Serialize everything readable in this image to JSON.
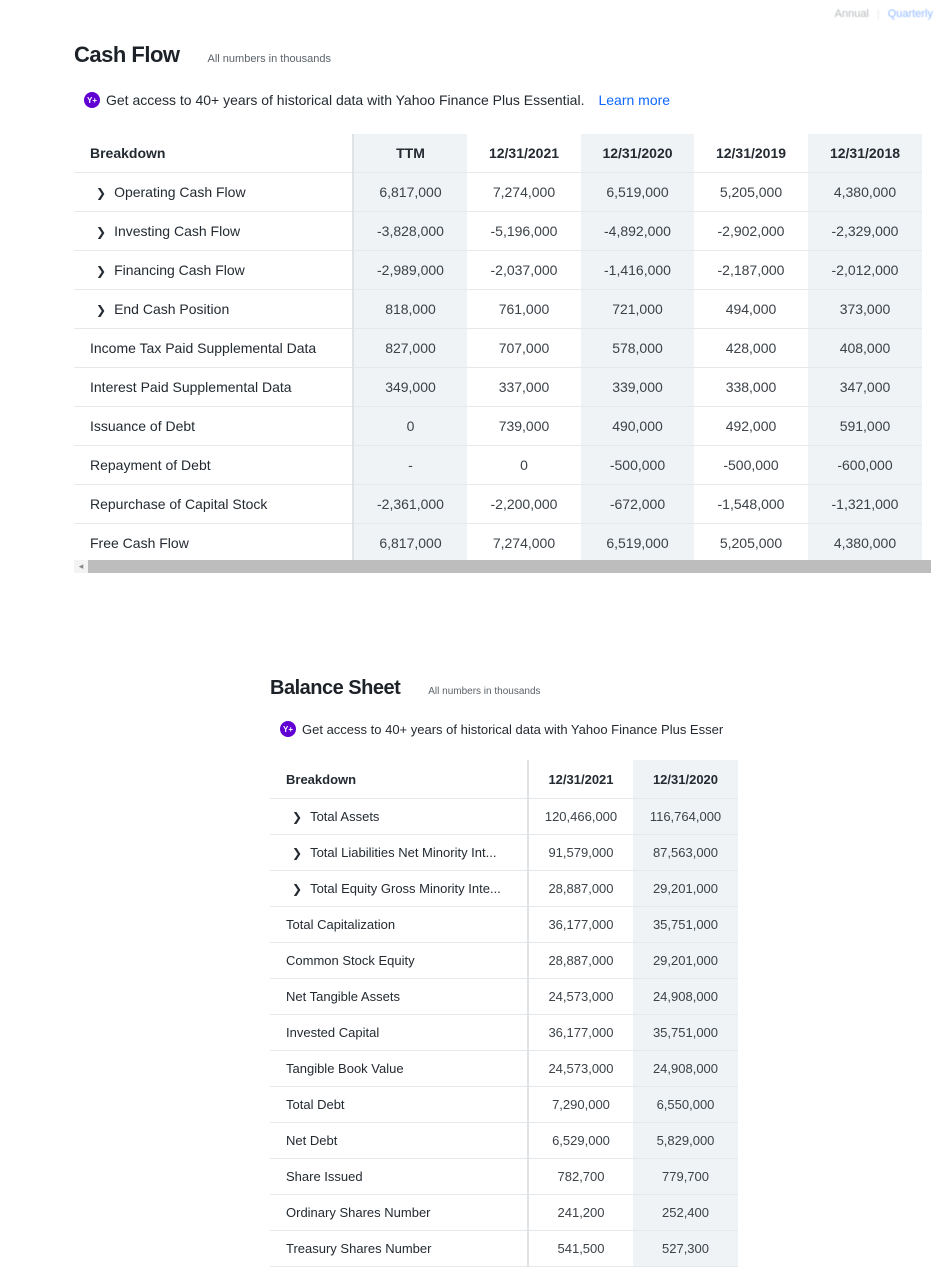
{
  "top_toggle": {
    "left": "Annual",
    "right": "Quarterly"
  },
  "cash_flow": {
    "title": "Cash Flow",
    "note": "All numbers in thousands",
    "promo_icon": "yahoo-plus-icon",
    "promo_icon_text": "Y+",
    "promo_text": "Get access to 40+ years of historical data with Yahoo Finance Plus Essential.",
    "promo_link": "Learn more",
    "columns": [
      "Breakdown",
      "TTM",
      "12/31/2021",
      "12/31/2020",
      "12/31/2019",
      "12/31/2018"
    ],
    "rows": [
      {
        "label": "Operating Cash Flow",
        "expandable": true,
        "values": [
          "6,817,000",
          "7,274,000",
          "6,519,000",
          "5,205,000",
          "4,380,000"
        ]
      },
      {
        "label": "Investing Cash Flow",
        "expandable": true,
        "values": [
          "-3,828,000",
          "-5,196,000",
          "-4,892,000",
          "-2,902,000",
          "-2,329,000"
        ]
      },
      {
        "label": "Financing Cash Flow",
        "expandable": true,
        "values": [
          "-2,989,000",
          "-2,037,000",
          "-1,416,000",
          "-2,187,000",
          "-2,012,000"
        ]
      },
      {
        "label": "End Cash Position",
        "expandable": true,
        "values": [
          "818,000",
          "761,000",
          "721,000",
          "494,000",
          "373,000"
        ]
      },
      {
        "label": "Income Tax Paid Supplemental Data",
        "expandable": false,
        "values": [
          "827,000",
          "707,000",
          "578,000",
          "428,000",
          "408,000"
        ]
      },
      {
        "label": "Interest Paid Supplemental Data",
        "expandable": false,
        "values": [
          "349,000",
          "337,000",
          "339,000",
          "338,000",
          "347,000"
        ]
      },
      {
        "label": "Issuance of Debt",
        "expandable": false,
        "values": [
          "0",
          "739,000",
          "490,000",
          "492,000",
          "591,000"
        ]
      },
      {
        "label": "Repayment of Debt",
        "expandable": false,
        "values": [
          "-",
          "0",
          "-500,000",
          "-500,000",
          "-600,000"
        ]
      },
      {
        "label": "Repurchase of Capital Stock",
        "expandable": false,
        "values": [
          "-2,361,000",
          "-2,200,000",
          "-672,000",
          "-1,548,000",
          "-1,321,000"
        ]
      },
      {
        "label": "Free Cash Flow",
        "expandable": false,
        "values": [
          "6,817,000",
          "7,274,000",
          "6,519,000",
          "5,205,000",
          "4,380,000"
        ]
      }
    ]
  },
  "balance_sheet": {
    "title": "Balance Sheet",
    "note": "All numbers in thousands",
    "promo_icon": "yahoo-plus-icon",
    "promo_icon_text": "Y+",
    "promo_text": "Get access to 40+ years of historical data with Yahoo Finance Plus Esser",
    "columns": [
      "Breakdown",
      "12/31/2021",
      "12/31/2020"
    ],
    "rows": [
      {
        "label": "Total Assets",
        "expandable": true,
        "values": [
          "120,466,000",
          "116,764,000"
        ]
      },
      {
        "label": "Total Liabilities Net Minority Int...",
        "expandable": true,
        "values": [
          "91,579,000",
          "87,563,000"
        ]
      },
      {
        "label": "Total Equity Gross Minority Inte...",
        "expandable": true,
        "values": [
          "28,887,000",
          "29,201,000"
        ]
      },
      {
        "label": "Total Capitalization",
        "expandable": false,
        "values": [
          "36,177,000",
          "35,751,000"
        ]
      },
      {
        "label": "Common Stock Equity",
        "expandable": false,
        "values": [
          "28,887,000",
          "29,201,000"
        ]
      },
      {
        "label": "Net Tangible Assets",
        "expandable": false,
        "values": [
          "24,573,000",
          "24,908,000"
        ]
      },
      {
        "label": "Invested Capital",
        "expandable": false,
        "values": [
          "36,177,000",
          "35,751,000"
        ]
      },
      {
        "label": "Tangible Book Value",
        "expandable": false,
        "values": [
          "24,573,000",
          "24,908,000"
        ]
      },
      {
        "label": "Total Debt",
        "expandable": false,
        "values": [
          "7,290,000",
          "6,550,000"
        ]
      },
      {
        "label": "Net Debt",
        "expandable": false,
        "values": [
          "6,529,000",
          "5,829,000"
        ]
      },
      {
        "label": "Share Issued",
        "expandable": false,
        "values": [
          "782,700",
          "779,700"
        ]
      },
      {
        "label": "Ordinary Shares Number",
        "expandable": false,
        "values": [
          "241,200",
          "252,400"
        ]
      },
      {
        "label": "Treasury Shares Number",
        "expandable": false,
        "values": [
          "541,500",
          "527,300"
        ]
      }
    ]
  },
  "scrollbar": {
    "left_arrow": "◂"
  },
  "colors": {
    "link": "#0f69ff",
    "promo_icon_bg": "#6001d2",
    "shaded_column": "#f0f3f5"
  }
}
